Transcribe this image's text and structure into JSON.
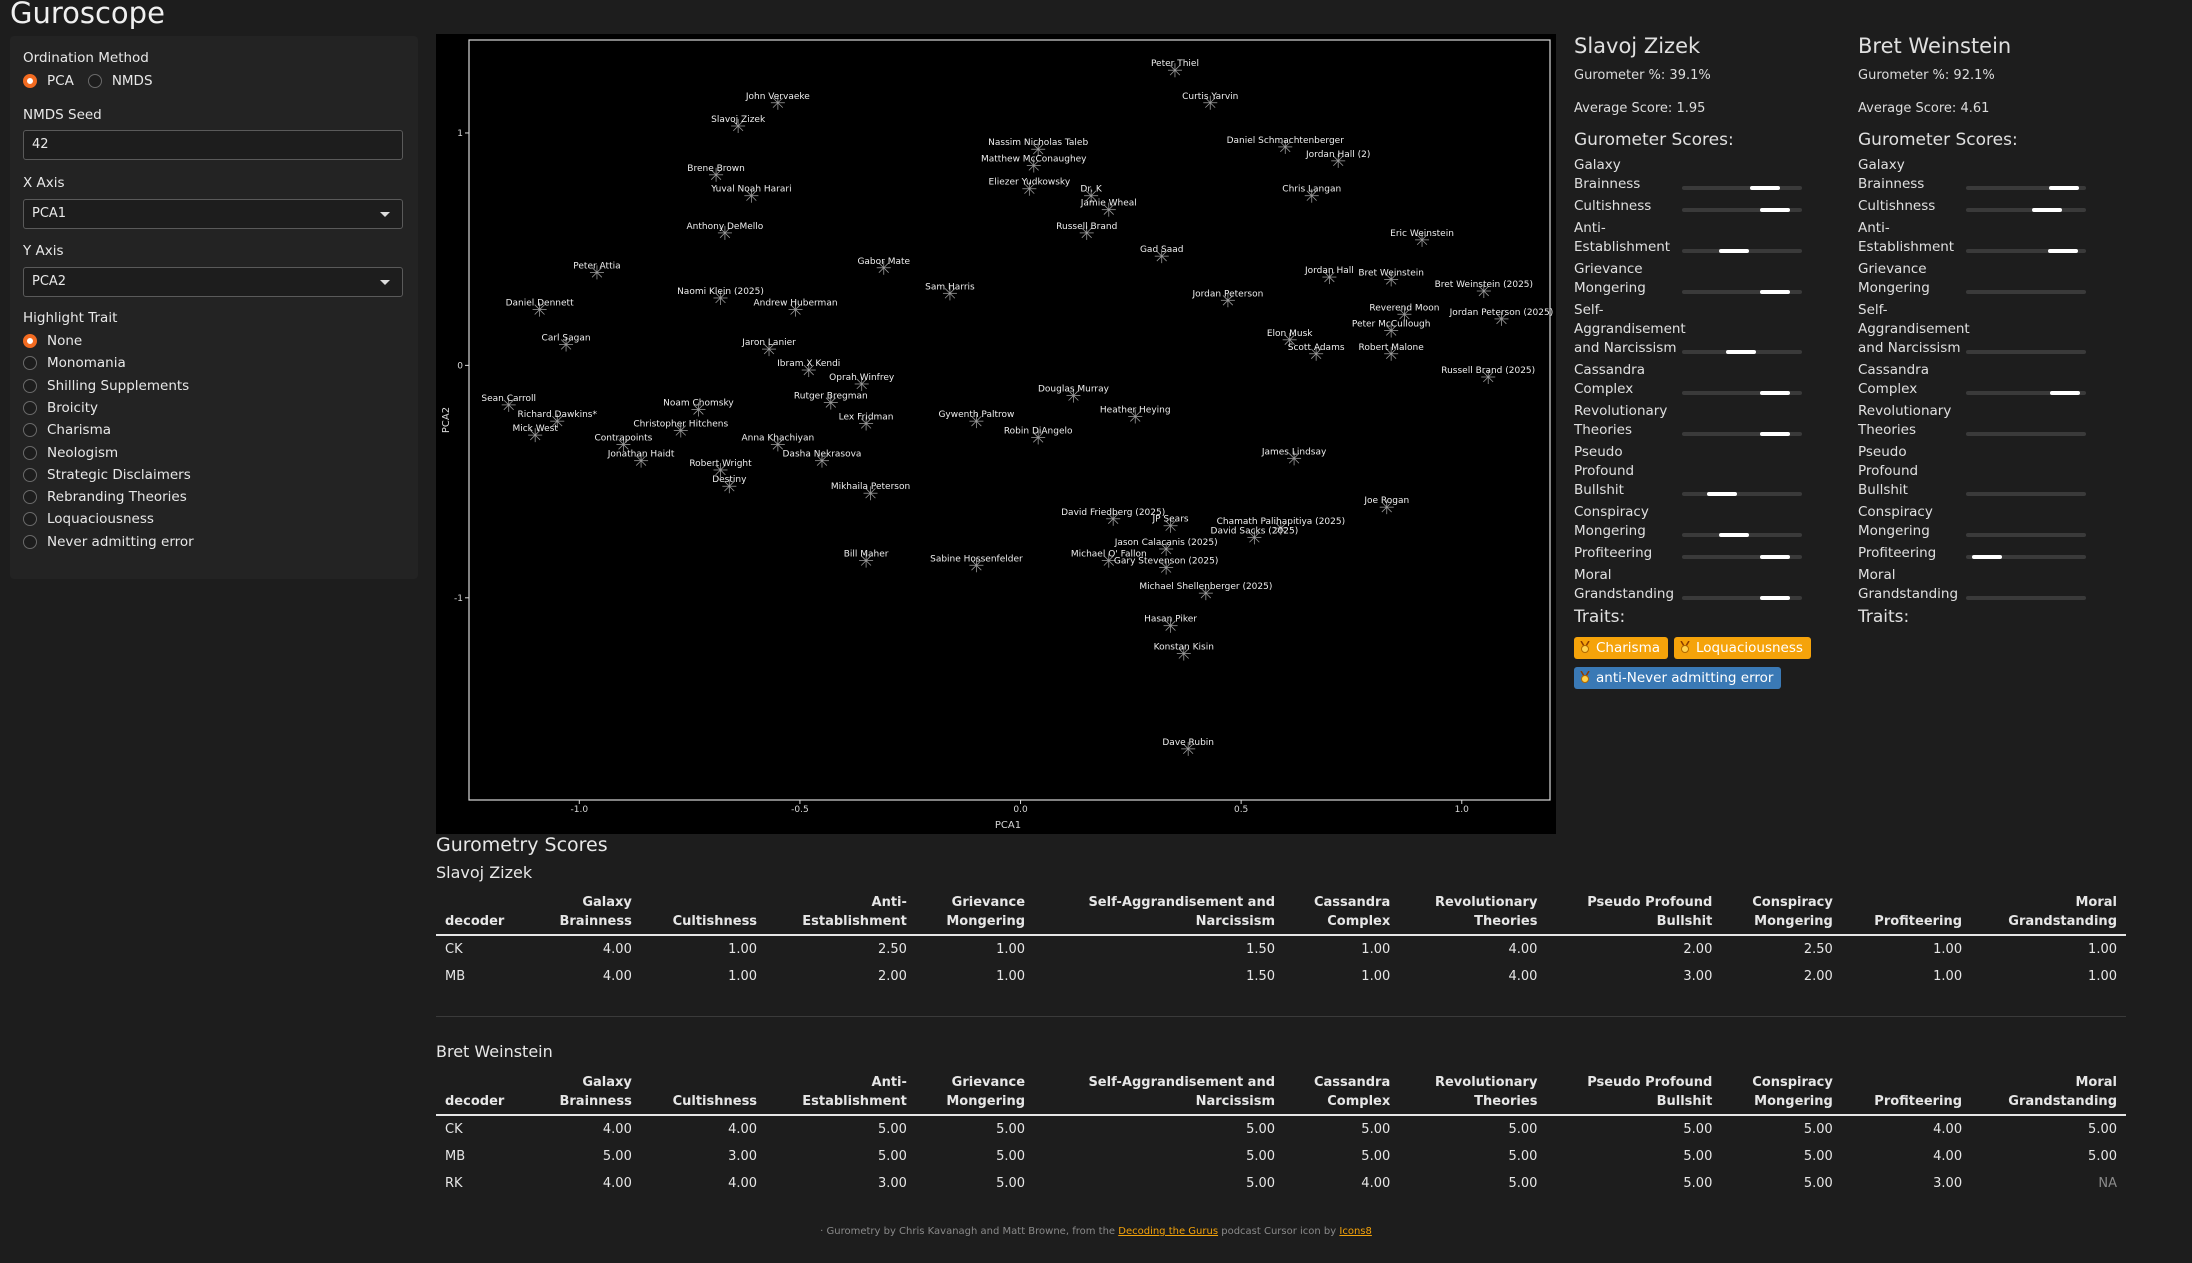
{
  "app": {
    "title": "Guroscope"
  },
  "sidebar": {
    "ordination_label": "Ordination Method",
    "ordination_options": [
      {
        "label": "PCA",
        "selected": true
      },
      {
        "label": "NMDS",
        "selected": false
      }
    ],
    "seed_label": "NMDS Seed",
    "seed_value": "42",
    "x_axis_label": "X Axis",
    "x_axis_value": "PCA1",
    "y_axis_label": "Y Axis",
    "y_axis_value": "PCA2",
    "highlight_label": "Highlight Trait",
    "traits": [
      {
        "label": "None",
        "selected": true
      },
      {
        "label": "Monomania",
        "selected": false
      },
      {
        "label": "Shilling Supplements",
        "selected": false
      },
      {
        "label": "Broicity",
        "selected": false
      },
      {
        "label": "Charisma",
        "selected": false
      },
      {
        "label": "Neologism",
        "selected": false
      },
      {
        "label": "Strategic Disclaimers",
        "selected": false
      },
      {
        "label": "Rebranding Theories",
        "selected": false
      },
      {
        "label": "Loquaciousness",
        "selected": false
      },
      {
        "label": "Never admitting error",
        "selected": false
      }
    ]
  },
  "chart_data": {
    "type": "scatter",
    "xlabel": "PCA1",
    "ylabel": "PCA2",
    "xlim": [
      -1.25,
      1.2
    ],
    "ylim": [
      -1.87,
      1.4
    ],
    "xticks": [
      "-1.0",
      "-0.5",
      "0.0",
      "0.5",
      "1.0"
    ],
    "yticks": [
      "1",
      "0",
      "-1"
    ],
    "points": [
      {
        "label": "Peter Thiel",
        "x": 0.35,
        "y": 1.27
      },
      {
        "label": "Curtis Yarvin",
        "x": 0.43,
        "y": 1.13
      },
      {
        "label": "John Vervaeke",
        "x": -0.55,
        "y": 1.13
      },
      {
        "label": "Slavoj Zizek",
        "x": -0.64,
        "y": 1.03
      },
      {
        "label": "Nassim Nicholas Taleb",
        "x": 0.04,
        "y": 0.93
      },
      {
        "label": "Matthew McConaughey",
        "x": 0.03,
        "y": 0.86
      },
      {
        "label": "Daniel Schmachtenberger",
        "x": 0.6,
        "y": 0.94
      },
      {
        "label": "Jordan Hall (2)",
        "x": 0.72,
        "y": 0.88
      },
      {
        "label": "Brene Brown",
        "x": -0.69,
        "y": 0.82
      },
      {
        "label": "Eliezer Yudkowsky",
        "x": 0.02,
        "y": 0.76
      },
      {
        "label": "Yuval Noah Harari",
        "x": -0.61,
        "y": 0.73
      },
      {
        "label": "Dr. K",
        "x": 0.16,
        "y": 0.73
      },
      {
        "label": "Chris Langan",
        "x": 0.66,
        "y": 0.73
      },
      {
        "label": "Jamie Wheal",
        "x": 0.2,
        "y": 0.67
      },
      {
        "label": "Anthony DeMello",
        "x": -0.67,
        "y": 0.57
      },
      {
        "label": "Russell Brand",
        "x": 0.15,
        "y": 0.57
      },
      {
        "label": "Eric Weinstein",
        "x": 0.91,
        "y": 0.54
      },
      {
        "label": "Gad Saad",
        "x": 0.32,
        "y": 0.47
      },
      {
        "label": "Gabor Mate",
        "x": -0.31,
        "y": 0.42
      },
      {
        "label": "Peter Attia",
        "x": -0.96,
        "y": 0.4
      },
      {
        "label": "Jordan Hall",
        "x": 0.7,
        "y": 0.38
      },
      {
        "label": "Bret Weinstein",
        "x": 0.84,
        "y": 0.37
      },
      {
        "label": "Bret Weinstein (2025)",
        "x": 1.05,
        "y": 0.32
      },
      {
        "label": "Naomi Klein (2025)",
        "x": -0.68,
        "y": 0.29
      },
      {
        "label": "Sam Harris",
        "x": -0.16,
        "y": 0.31
      },
      {
        "label": "Jordan Peterson",
        "x": 0.47,
        "y": 0.28
      },
      {
        "label": "Daniel Dennett",
        "x": -1.09,
        "y": 0.24
      },
      {
        "label": "Andrew Huberman",
        "x": -0.51,
        "y": 0.24
      },
      {
        "label": "Reverend Moon",
        "x": 0.87,
        "y": 0.22
      },
      {
        "label": "Jordan Peterson (2025)",
        "x": 1.09,
        "y": 0.2
      },
      {
        "label": "Peter McCullough",
        "x": 0.84,
        "y": 0.15
      },
      {
        "label": "Elon Musk",
        "x": 0.61,
        "y": 0.11
      },
      {
        "label": "Carl Sagan",
        "x": -1.03,
        "y": 0.09
      },
      {
        "label": "Jaron Lanier",
        "x": -0.57,
        "y": 0.07
      },
      {
        "label": "Robert Malone",
        "x": 0.84,
        "y": 0.05
      },
      {
        "label": "Scott Adams",
        "x": 0.67,
        "y": 0.05
      },
      {
        "label": "Ibram X Kendi",
        "x": -0.48,
        "y": -0.02
      },
      {
        "label": "Russell Brand (2025)",
        "x": 1.06,
        "y": -0.05
      },
      {
        "label": "Oprah Winfrey",
        "x": -0.36,
        "y": -0.08
      },
      {
        "label": "Douglas Murray",
        "x": 0.12,
        "y": -0.13
      },
      {
        "label": "Rutger Bregman",
        "x": -0.43,
        "y": -0.16
      },
      {
        "label": "Sean Carroll",
        "x": -1.16,
        "y": -0.17
      },
      {
        "label": "Noam Chomsky",
        "x": -0.73,
        "y": -0.19
      },
      {
        "label": "Heather Heying",
        "x": 0.26,
        "y": -0.22
      },
      {
        "label": "Richard Dawkins*",
        "x": -1.05,
        "y": -0.24
      },
      {
        "label": "Gywenth Paltrow",
        "x": -0.1,
        "y": -0.24
      },
      {
        "label": "Lex Fridman",
        "x": -0.35,
        "y": -0.25
      },
      {
        "label": "Christopher Hitchens",
        "x": -0.77,
        "y": -0.28
      },
      {
        "label": "Mick West",
        "x": -1.1,
        "y": -0.3
      },
      {
        "label": "Robin DiAngelo",
        "x": 0.04,
        "y": -0.31
      },
      {
        "label": "Contrapoints",
        "x": -0.9,
        "y": -0.34
      },
      {
        "label": "Anna Khachiyan",
        "x": -0.55,
        "y": -0.34
      },
      {
        "label": "Jonathan Haidt",
        "x": -0.86,
        "y": -0.41
      },
      {
        "label": "Dasha Nekrasova",
        "x": -0.45,
        "y": -0.41
      },
      {
        "label": "James Lindsay",
        "x": 0.62,
        "y": -0.4
      },
      {
        "label": "Robert Wright",
        "x": -0.68,
        "y": -0.45
      },
      {
        "label": "Destiny",
        "x": -0.66,
        "y": -0.52
      },
      {
        "label": "Mikhaila Peterson",
        "x": -0.34,
        "y": -0.55
      },
      {
        "label": "David Friedberg (2025)",
        "x": 0.21,
        "y": -0.66
      },
      {
        "label": "Joe Rogan",
        "x": 0.83,
        "y": -0.61
      },
      {
        "label": "Chamath Palihapitiya (2025)",
        "x": 0.59,
        "y": -0.7
      },
      {
        "label": "JP Sears",
        "x": 0.34,
        "y": -0.69
      },
      {
        "label": "David Sacks (2025)",
        "x": 0.53,
        "y": -0.74
      },
      {
        "label": "Jason Calacanis (2025)",
        "x": 0.33,
        "y": -0.79
      },
      {
        "label": "Bill Maher",
        "x": -0.35,
        "y": -0.84
      },
      {
        "label": "Sabine Hossenfelder",
        "x": -0.1,
        "y": -0.86
      },
      {
        "label": "Michael O' Fallon",
        "x": 0.2,
        "y": -0.84
      },
      {
        "label": "Gary Stevenson (2025)",
        "x": 0.33,
        "y": -0.87
      },
      {
        "label": "Michael Shellenberger (2025)",
        "x": 0.42,
        "y": -0.98
      },
      {
        "label": "Hasan Piker",
        "x": 0.34,
        "y": -1.12
      },
      {
        "label": "Konstan Kisin",
        "x": 0.37,
        "y": -1.24
      },
      {
        "label": "Dave Rubin",
        "x": 0.38,
        "y": -1.65
      }
    ]
  },
  "profiles": [
    {
      "name": "Slavoj Zizek",
      "gurometer": "Gurometer %: 39.1%",
      "average": "Average Score: 1.95",
      "scores_head": "Gurometer Scores:",
      "traits_head": "Traits:",
      "scores": [
        0.82,
        0.9,
        0.56,
        0.9,
        0.62,
        0.9,
        0.9,
        0.46,
        0.56,
        0.9,
        0.9
      ],
      "badges": [
        {
          "label": "Charisma",
          "color": "orange"
        },
        {
          "label": "Loquaciousness",
          "color": "orange"
        },
        {
          "label": "anti-Never admitting error",
          "color": "blue"
        }
      ]
    },
    {
      "name": "Bret Weinstein",
      "gurometer": "Gurometer %: 92.1%",
      "average": "Average Score: 4.61",
      "scores_head": "Gurometer Scores:",
      "traits_head": "Traits:",
      "scores": [
        0.94,
        0.8,
        0.93,
        0.0,
        0.0,
        0.95,
        0.0,
        0.0,
        0.0,
        0.3,
        0.0
      ],
      "badges": []
    }
  ],
  "score_names": [
    "Galaxy Brainness",
    "Cultishness",
    "Anti-Establishment",
    "Grievance Mongering",
    "Self-Aggrandisement and Narcissism",
    "Cassandra Complex",
    "Revolutionary Theories",
    "Pseudo Profound Bullshit",
    "Conspiracy Mongering",
    "Profiteering",
    "Moral Grandstanding"
  ],
  "tables": {
    "title": "Gurometry Scores",
    "headers": [
      [
        "decoder"
      ],
      [
        "Galaxy",
        "Brainness"
      ],
      [
        "Cultishness"
      ],
      [
        "Anti-",
        "Establishment"
      ],
      [
        "Grievance",
        "Mongering"
      ],
      [
        "Self-Aggrandisement and",
        "Narcissism"
      ],
      [
        "Cassandra",
        "Complex"
      ],
      [
        "Revolutionary",
        "Theories"
      ],
      [
        "Pseudo Profound",
        "Bullshit"
      ],
      [
        "Conspiracy",
        "Mongering"
      ],
      [
        "Profiteering"
      ],
      [
        "Moral",
        "Grandstanding"
      ]
    ],
    "groups": [
      {
        "name": "Slavoj Zizek",
        "rows": [
          [
            "CK",
            "4.00",
            "1.00",
            "2.50",
            "1.00",
            "1.50",
            "1.00",
            "4.00",
            "2.00",
            "2.50",
            "1.00",
            "1.00"
          ],
          [
            "MB",
            "4.00",
            "1.00",
            "2.00",
            "1.00",
            "1.50",
            "1.00",
            "4.00",
            "3.00",
            "2.00",
            "1.00",
            "1.00"
          ]
        ]
      },
      {
        "name": "Bret Weinstein",
        "rows": [
          [
            "CK",
            "4.00",
            "4.00",
            "5.00",
            "5.00",
            "5.00",
            "5.00",
            "5.00",
            "5.00",
            "5.00",
            "4.00",
            "5.00"
          ],
          [
            "MB",
            "5.00",
            "3.00",
            "5.00",
            "5.00",
            "5.00",
            "5.00",
            "5.00",
            "5.00",
            "5.00",
            "4.00",
            "5.00"
          ],
          [
            "RK",
            "4.00",
            "4.00",
            "3.00",
            "5.00",
            "5.00",
            "4.00",
            "5.00",
            "5.00",
            "5.00",
            "3.00",
            "NA"
          ]
        ]
      }
    ]
  },
  "footer": {
    "prefix": "· Gurometry by Chris Kavanagh and Matt Browne, from the ",
    "link1": "Decoding the Gurus",
    "mid": " podcast Cursor icon by ",
    "link2": "Icons8"
  },
  "colors": {
    "accent": "#f26b21",
    "badge_orange": "#f5a30a",
    "badge_blue": "#3a79b5",
    "plot_bg": "#000000"
  }
}
